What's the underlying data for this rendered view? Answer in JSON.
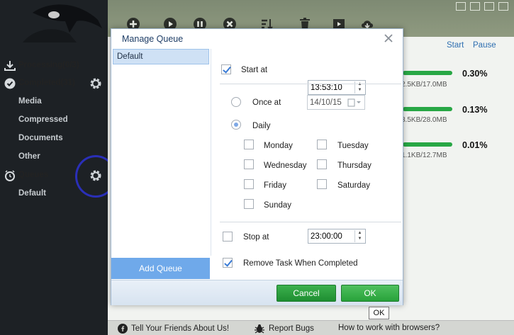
{
  "sidebar": {
    "logo_icon": "eagle-logo-icon",
    "items": [
      {
        "label": "Processing(0/3)",
        "icon": "download-icon"
      },
      {
        "label": "Completed(31)",
        "icon": "check-circle-icon"
      },
      {
        "label": "Media"
      },
      {
        "label": "Compressed"
      },
      {
        "label": "Documents"
      },
      {
        "label": "Other"
      },
      {
        "label": "Queues",
        "icon": "clock-icon"
      },
      {
        "label": "Default"
      }
    ]
  },
  "list": {
    "columns": {
      "start": "Start",
      "pause": "Pause"
    },
    "rows": [
      {
        "percent": "0.30%",
        "size": "2.5KB/17.0MB"
      },
      {
        "percent": "0.13%",
        "size": "3.5KB/28.0MB"
      },
      {
        "percent": "0.01%",
        "size": "1.1KB/12.7MB"
      }
    ]
  },
  "footer": {
    "tell_friends": "Tell Your Friends About Us!",
    "report_bugs": "Report Bugs",
    "browsers": "How to work with browsers?"
  },
  "dialog": {
    "title": "Manage Queue",
    "queues": [
      "Default"
    ],
    "add_queue": "Add Queue",
    "start_at": {
      "label": "Start at",
      "checked": true,
      "value": "13:53:10"
    },
    "once_at": {
      "label": "Once at",
      "value": "14/10/15"
    },
    "daily": {
      "label": "Daily"
    },
    "days": {
      "monday": "Monday",
      "tuesday": "Tuesday",
      "wednesday": "Wednesday",
      "thursday": "Thursday",
      "friday": "Friday",
      "saturday": "Saturday",
      "sunday": "Sunday"
    },
    "stop_at": {
      "label": "Stop at",
      "checked": false,
      "value": "23:00:00"
    },
    "remove_task": {
      "label": "Remove Task When Completed",
      "checked": true
    },
    "cancel": "Cancel",
    "ok": "OK"
  },
  "tooltip": "OK",
  "colors": {
    "accent": "#6fa9ea",
    "ok_green": "#28a23a",
    "highlight": "#2a2fb8"
  }
}
